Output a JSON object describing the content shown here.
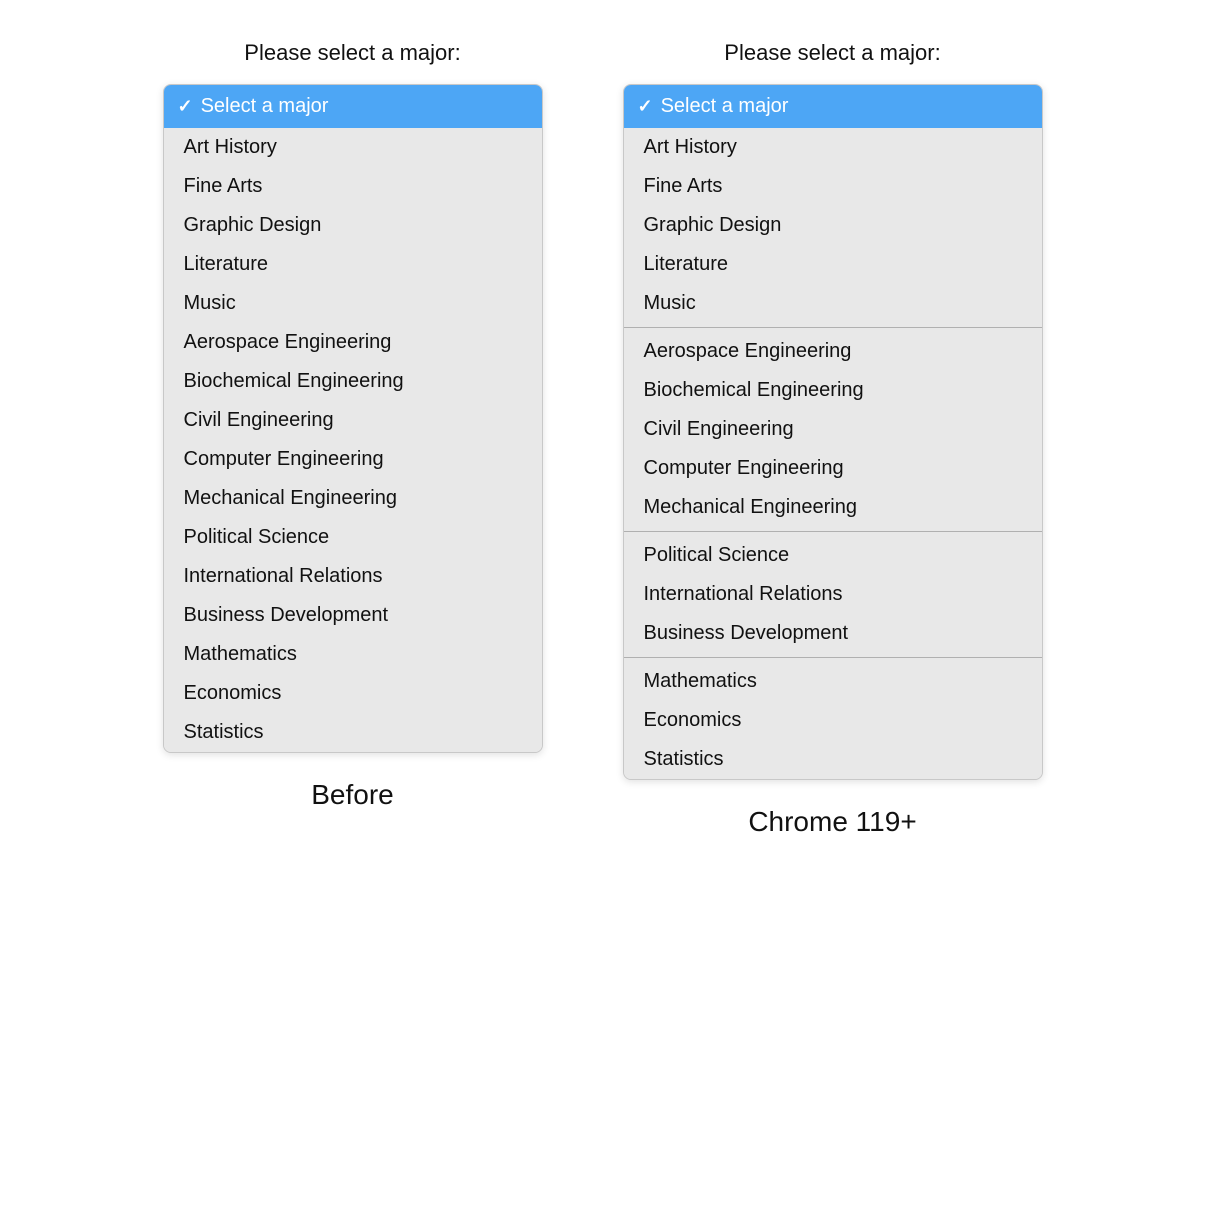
{
  "before": {
    "label": "Please select a major:",
    "caption": "Before",
    "selected": "Select a major",
    "options": [
      {
        "value": "art-history",
        "label": "Art History"
      },
      {
        "value": "fine-arts",
        "label": "Fine Arts"
      },
      {
        "value": "graphic-design",
        "label": "Graphic Design"
      },
      {
        "value": "literature",
        "label": "Literature"
      },
      {
        "value": "music",
        "label": "Music"
      },
      {
        "value": "aerospace-engineering",
        "label": "Aerospace Engineering"
      },
      {
        "value": "biochemical-engineering",
        "label": "Biochemical Engineering"
      },
      {
        "value": "civil-engineering",
        "label": "Civil Engineering"
      },
      {
        "value": "computer-engineering",
        "label": "Computer Engineering"
      },
      {
        "value": "mechanical-engineering",
        "label": "Mechanical Engineering"
      },
      {
        "value": "political-science",
        "label": "Political Science"
      },
      {
        "value": "international-relations",
        "label": "International Relations"
      },
      {
        "value": "business-development",
        "label": "Business Development"
      },
      {
        "value": "mathematics",
        "label": "Mathematics"
      },
      {
        "value": "economics",
        "label": "Economics"
      },
      {
        "value": "statistics",
        "label": "Statistics"
      }
    ]
  },
  "chrome": {
    "label": "Please select a major:",
    "caption": "Chrome 119+",
    "selected": "Select a major",
    "groups": [
      {
        "items": [
          {
            "value": "art-history",
            "label": "Art History"
          },
          {
            "value": "fine-arts",
            "label": "Fine Arts"
          },
          {
            "value": "graphic-design",
            "label": "Graphic Design"
          },
          {
            "value": "literature",
            "label": "Literature"
          },
          {
            "value": "music",
            "label": "Music"
          }
        ]
      },
      {
        "items": [
          {
            "value": "aerospace-engineering",
            "label": "Aerospace Engineering"
          },
          {
            "value": "biochemical-engineering",
            "label": "Biochemical Engineering"
          },
          {
            "value": "civil-engineering",
            "label": "Civil Engineering"
          },
          {
            "value": "computer-engineering",
            "label": "Computer Engineering"
          },
          {
            "value": "mechanical-engineering",
            "label": "Mechanical Engineering"
          }
        ]
      },
      {
        "items": [
          {
            "value": "political-science",
            "label": "Political Science"
          },
          {
            "value": "international-relations",
            "label": "International Relations"
          },
          {
            "value": "business-development",
            "label": "Business Development"
          }
        ]
      },
      {
        "items": [
          {
            "value": "mathematics",
            "label": "Mathematics"
          },
          {
            "value": "economics",
            "label": "Economics"
          },
          {
            "value": "statistics",
            "label": "Statistics"
          }
        ]
      }
    ]
  },
  "icons": {
    "checkmark": "✓"
  }
}
